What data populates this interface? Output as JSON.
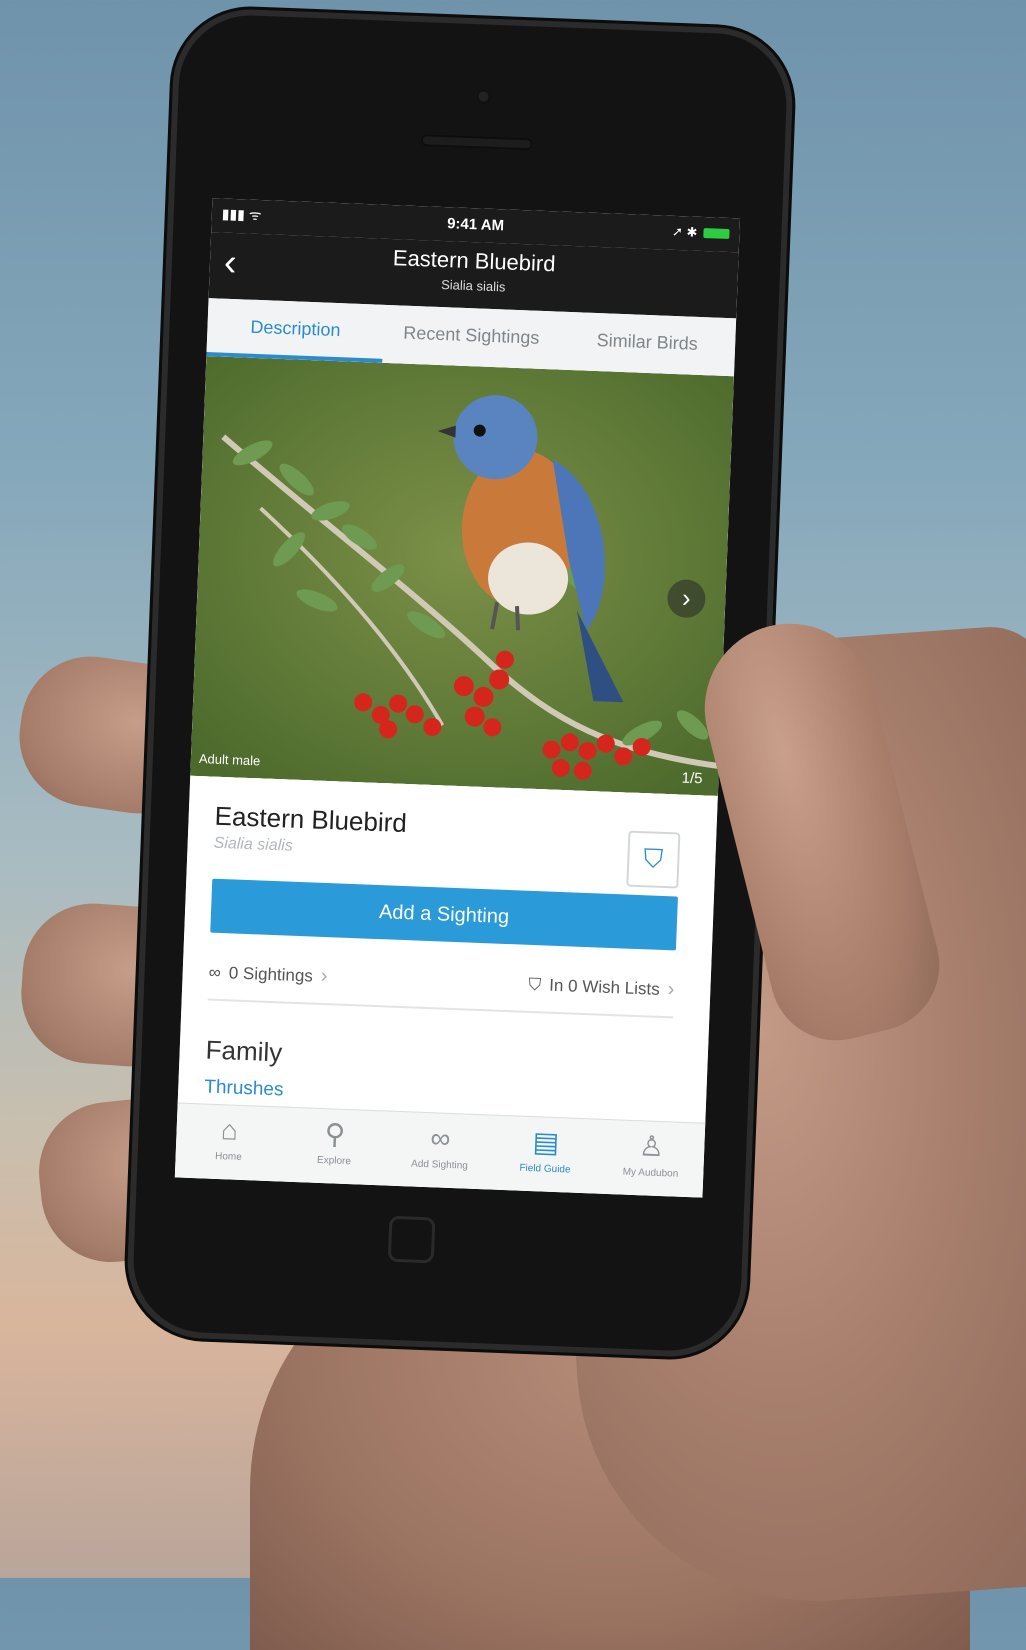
{
  "status": {
    "signal": "▮▮▮ ᯤ",
    "time": "9:41 AM",
    "indicators": "➚ ✱"
  },
  "nav": {
    "back": "‹",
    "title": "Eastern Bluebird",
    "subtitle": "Sialia sialis"
  },
  "tabs": [
    {
      "label": "Description",
      "active": true
    },
    {
      "label": "Recent Sightings",
      "active": false
    },
    {
      "label": "Similar Birds",
      "active": false
    }
  ],
  "photo": {
    "caption": "Adult male",
    "counter": "1/5",
    "next": "›"
  },
  "bird": {
    "name": "Eastern Bluebird",
    "latin": "Sialia sialis",
    "bookmark_icon": "⛉",
    "add_sighting": "Add a Sighting",
    "sightings": "0 Sightings",
    "wish_lists": "In 0 Wish Lists",
    "family_label": "Family",
    "family_value": "Thrushes"
  },
  "bottom_nav": [
    {
      "icon": "⌂",
      "icon_name": "home-icon",
      "label": "Home"
    },
    {
      "icon": "⚲",
      "icon_name": "location-pin-icon",
      "label": "Explore"
    },
    {
      "icon": "∞",
      "icon_name": "binoculars-icon",
      "label": "Add Sighting"
    },
    {
      "icon": "▤",
      "icon_name": "field-guide-icon",
      "label": "Field Guide",
      "active": true
    },
    {
      "icon": "♙",
      "icon_name": "person-icon",
      "label": "My Audubon"
    }
  ],
  "colors": {
    "accent": "#2a8ccf",
    "button": "#2a9ad8",
    "status_bar": "#1b1b1b"
  }
}
